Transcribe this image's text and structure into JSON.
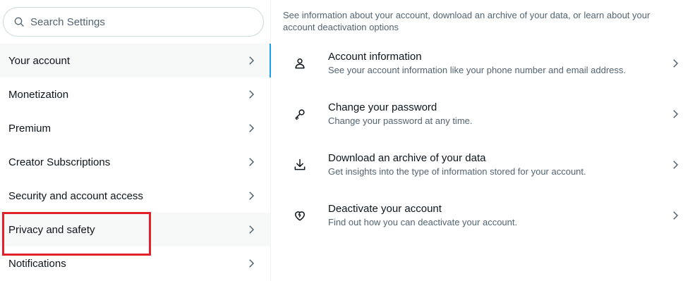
{
  "search": {
    "placeholder": "Search Settings"
  },
  "sidebar": {
    "items": [
      {
        "label": "Your account"
      },
      {
        "label": "Monetization"
      },
      {
        "label": "Premium"
      },
      {
        "label": "Creator Subscriptions"
      },
      {
        "label": "Security and account access"
      },
      {
        "label": "Privacy and safety"
      },
      {
        "label": "Notifications"
      }
    ]
  },
  "main": {
    "description": "See information about your account, download an archive of your data, or learn about your account deactivation options",
    "options": [
      {
        "title": "Account information",
        "subtitle": "See your account information like your phone number and email address.",
        "icon": "person-icon"
      },
      {
        "title": "Change your password",
        "subtitle": "Change your password at any time.",
        "icon": "key-icon"
      },
      {
        "title": "Download an archive of your data",
        "subtitle": "Get insights into the type of information stored for your account.",
        "icon": "download-icon"
      },
      {
        "title": "Deactivate your account",
        "subtitle": "Find out how you can deactivate your account.",
        "icon": "broken-heart-icon"
      }
    ]
  },
  "colors": {
    "accent": "#1d9bf0",
    "annotation": "#e0202b",
    "text": "#0f1419",
    "muted": "#536471"
  }
}
